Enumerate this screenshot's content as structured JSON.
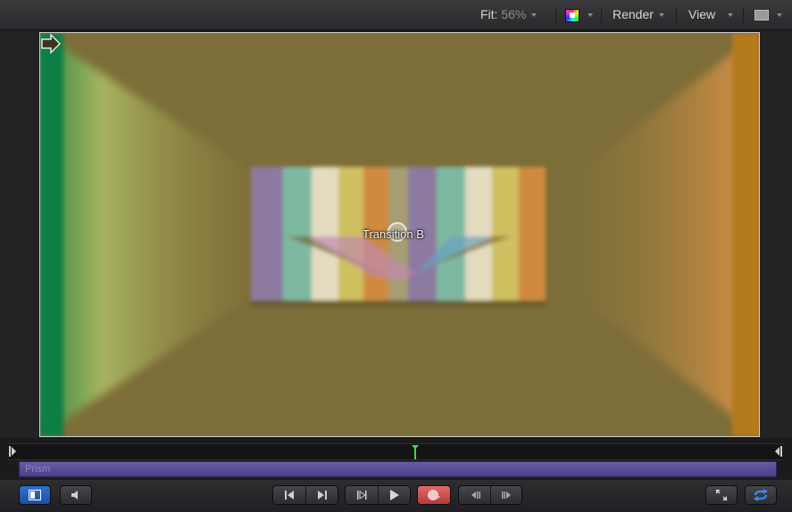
{
  "toolbar": {
    "fit_label": "Fit:",
    "fit_value": "56%",
    "render_label": "Render",
    "view_label": "View",
    "icons": [
      "color-channels-icon",
      "view-layout-icon"
    ]
  },
  "canvas": {
    "transition_label": "Transition B",
    "background_color": "#7f6f3a"
  },
  "timeline": {
    "clip_label": "Prism",
    "clip_color": "#5a4a9a",
    "playhead_color": "#4bd04b"
  },
  "transport": {
    "left_buttons": [
      "show-hide-timeline-icon",
      "audio-mute-icon"
    ],
    "playback_buttons": [
      "go-to-start-icon",
      "go-to-end-icon",
      "play-from-start-icon",
      "play-icon",
      "record-icon",
      "previous-frame-icon",
      "next-frame-icon"
    ],
    "right_buttons": [
      "fullscreen-icon",
      "loop-icon"
    ]
  }
}
